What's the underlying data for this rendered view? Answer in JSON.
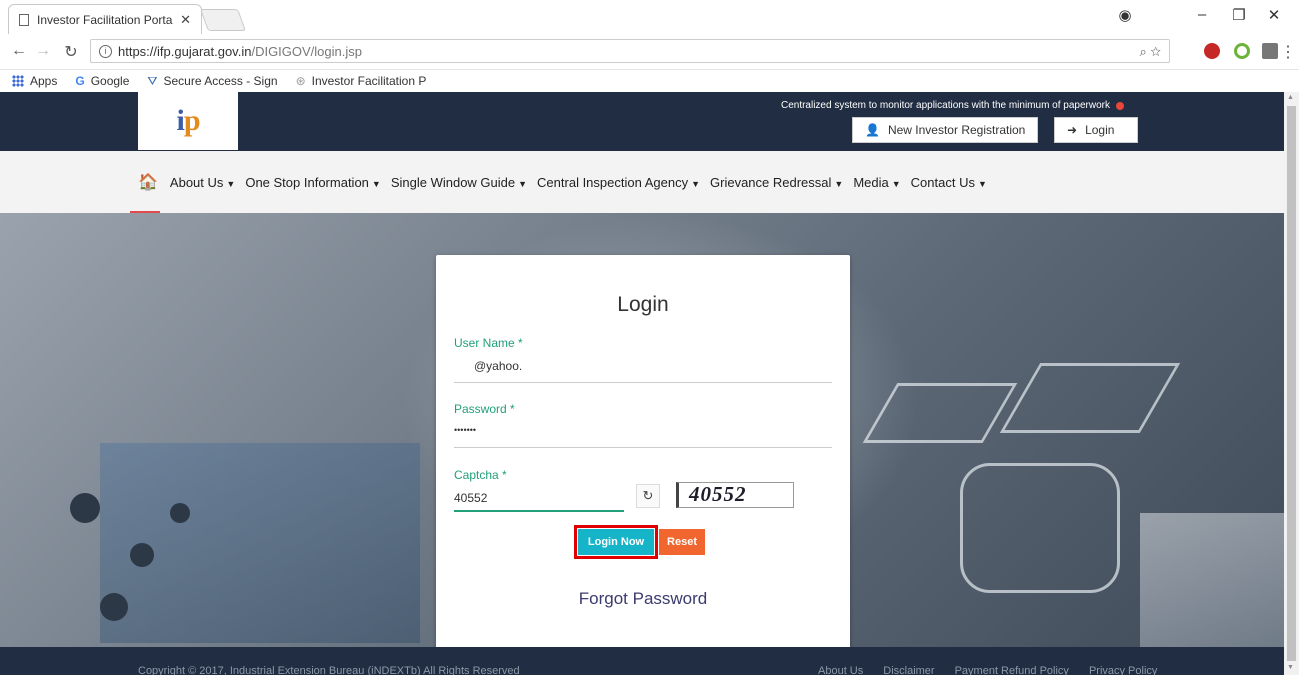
{
  "browser": {
    "tab_title": "Investor Facilitation Porta",
    "url_host": "https://ifp.gujarat.gov.in",
    "url_path": "/DIGIGOV/login.jsp",
    "bookmarks": [
      "Apps",
      "Google",
      "Secure Access - Sign",
      "Investor Facilitation P"
    ]
  },
  "header": {
    "logo_text": "ip",
    "tagline": "Centralized system to monitor applications with the minimum of paperwork",
    "register_label": "New Investor Registration",
    "login_label": "Login"
  },
  "nav": {
    "items": [
      {
        "label": "About Us"
      },
      {
        "label": "One Stop Information"
      },
      {
        "label": "Single Window Guide"
      },
      {
        "label": "Central Inspection Agency"
      },
      {
        "label": "Grievance Redressal"
      },
      {
        "label": "Media"
      },
      {
        "label": "Contact Us"
      }
    ]
  },
  "login": {
    "title": "Login",
    "username_label": "User Name *",
    "username_value": "@yahoo.",
    "password_label": "Password *",
    "password_value": "•••••••",
    "captcha_label": "Captcha *",
    "captcha_value": "40552",
    "captcha_image_text": "40552",
    "login_button": "Login Now",
    "reset_button": "Reset",
    "forgot_link": "Forgot Password"
  },
  "footer": {
    "copyright": "Copyright © 2017, Industrial Extension Bureau (iNDEXTb) All Rights Reserved",
    "links": [
      "About Us",
      "Disclaimer",
      "Payment Refund Policy",
      "Privacy Policy"
    ]
  },
  "colors": {
    "header_bg": "#202d42",
    "accent_green": "#21a07a",
    "login_btn": "#16b4c9",
    "reset_btn": "#f0662e",
    "highlight": "#e00000"
  }
}
